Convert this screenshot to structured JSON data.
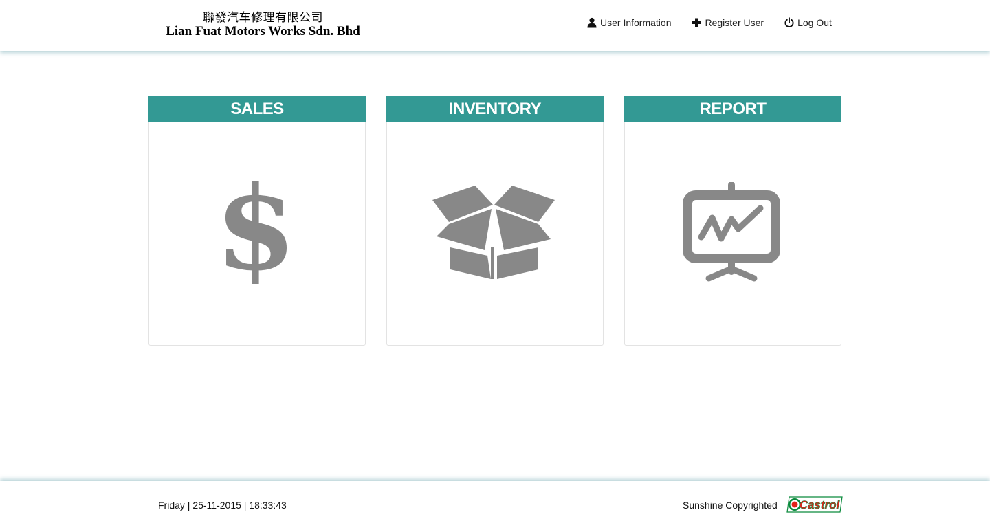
{
  "brand": {
    "name_cn": "聯發汽车修理有限公司",
    "name_en": "Lian Fuat Motors Works Sdn. Bhd"
  },
  "nav": {
    "user_info": "User Information",
    "register": "Register User",
    "logout": "Log Out"
  },
  "cards": [
    {
      "title": "SALES",
      "icon": "dollar-icon"
    },
    {
      "title": "INVENTORY",
      "icon": "open-box-icon"
    },
    {
      "title": "REPORT",
      "icon": "presentation-chart-icon"
    }
  ],
  "footer": {
    "datetime": "Friday | 25-11-2015 | 18:33:43",
    "copyright": "Sunshine Copyrighted",
    "logo_text": "Castrol"
  },
  "colors": {
    "accent": "#339994",
    "icon_gray": "#888888",
    "logo_green": "#0a8a3c",
    "logo_red": "#e2231a"
  }
}
